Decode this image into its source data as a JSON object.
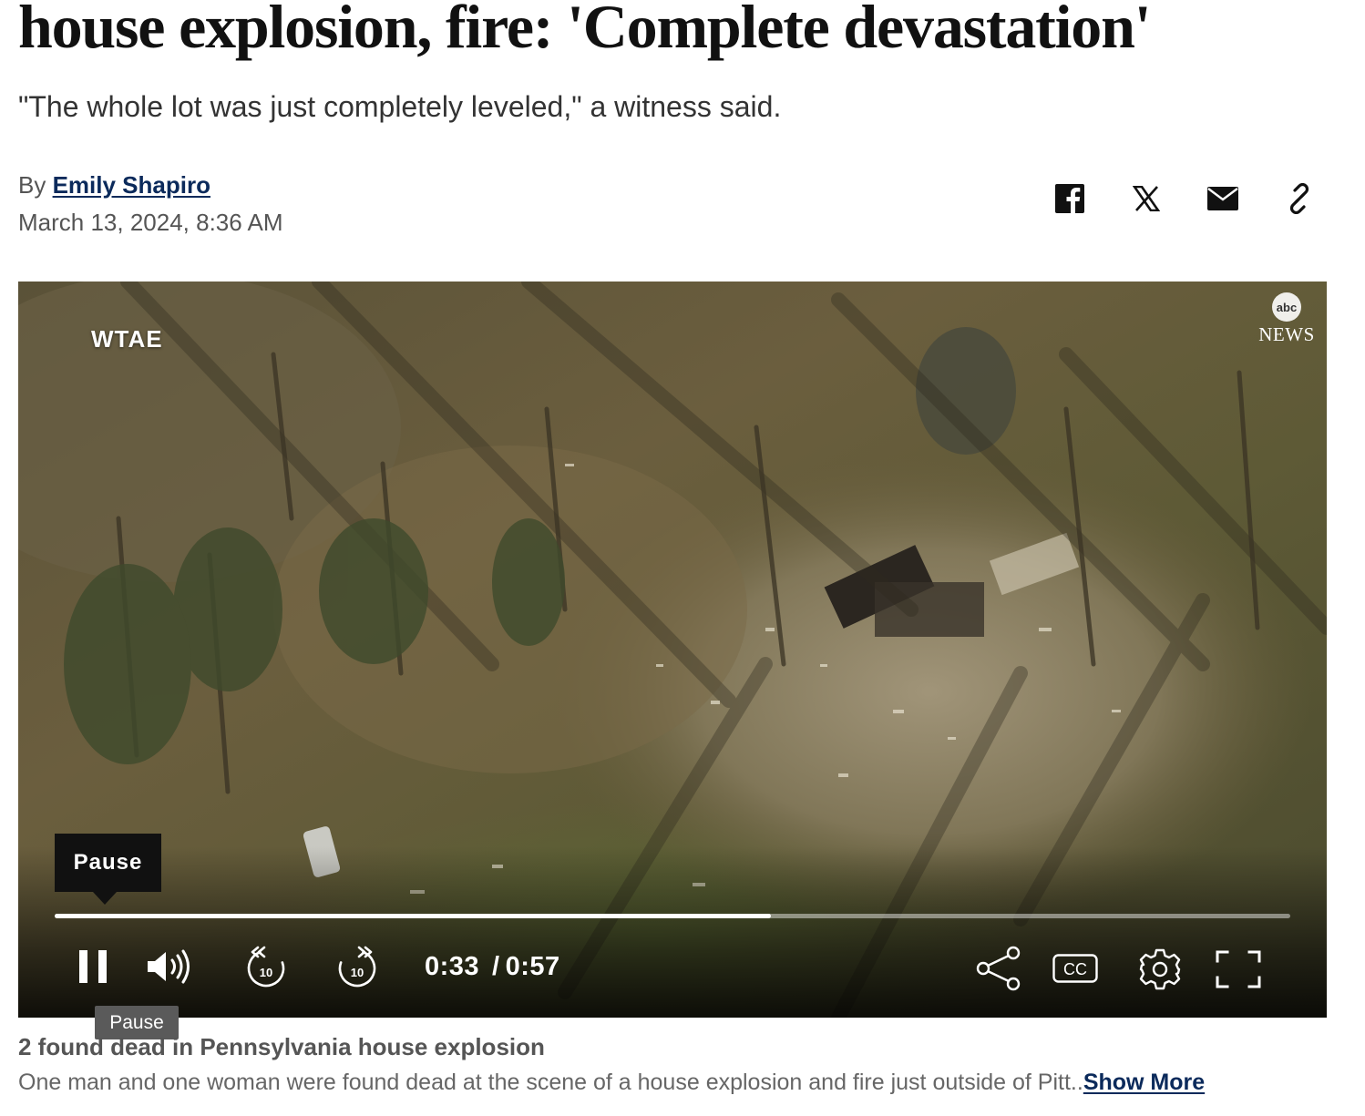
{
  "article": {
    "headline": "house explosion, fire: 'Complete devastation'",
    "subhead": "\"The whole lot was just completely leveled,\" a witness said.",
    "byline_prefix": "By",
    "author": "Emily Shapiro",
    "date": "March 13, 2024, 8:36 AM"
  },
  "share": {
    "icons": [
      "facebook-icon",
      "x-icon",
      "email-icon",
      "link-icon"
    ]
  },
  "video": {
    "station_bug": "WTAE",
    "network_logo_small": "abc",
    "network_logo_word": "NEWS",
    "tooltip_label": "Pause",
    "hover_tooltip_label": "Pause",
    "current_time": "0:33",
    "separator": "/",
    "duration": "0:57",
    "progress_fraction": 0.58,
    "controls": [
      "pause-icon",
      "volume-icon",
      "rewind-10-icon",
      "forward-10-icon",
      "share-icon",
      "cc-icon",
      "settings-icon",
      "fullscreen-icon"
    ],
    "skip_seconds_label": "10",
    "cc_label": "CC"
  },
  "caption": {
    "title": "2 found dead in Pennsylvania house explosion",
    "description": "One man and one woman were found dead at the scene of a house explosion and fire just outside of Pitt..",
    "show_more": "Show More"
  },
  "colors": {
    "link": "#0b2a5b",
    "control_white": "#ffffff",
    "tooltip_bg": "#111111"
  }
}
